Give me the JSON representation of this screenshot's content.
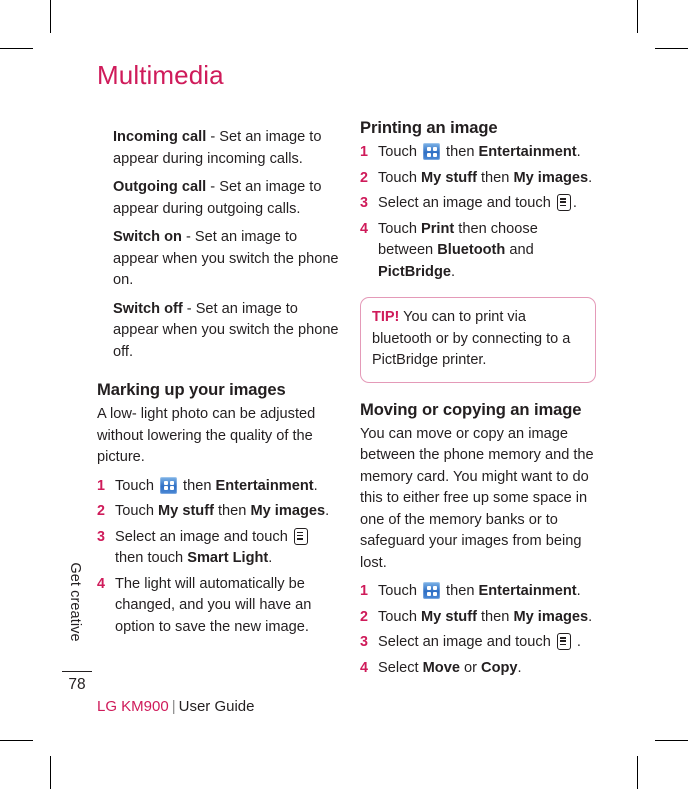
{
  "chapter": {
    "title": "Multimedia"
  },
  "side_tab": {
    "label": "Get creative",
    "page_number": "78"
  },
  "footer": {
    "brand": "LG KM900",
    "separator": "|",
    "guide": "User Guide"
  },
  "colors": {
    "accent": "#cf1b5a",
    "text": "#231f20",
    "tip_border": "#e49ab8",
    "icon_blue": "#2f6fc4"
  },
  "left_column": {
    "definitions": [
      {
        "term": "Incoming call",
        "desc": " - Set an image to appear during incoming calls."
      },
      {
        "term": "Outgoing call",
        "desc": " - Set an image to appear during outgoing calls."
      },
      {
        "term": "Switch on",
        "desc": " - Set an image to appear when you switch the phone on."
      },
      {
        "term": "Switch off",
        "desc": " - Set an image to appear when you switch the phone off."
      }
    ],
    "section": {
      "heading": "Marking up your images",
      "intro": "A low- light photo can be adjusted without lowering the quality of the picture.",
      "steps": [
        {
          "num": "1",
          "pre": "Touch ",
          "icon": "grid-apps-icon",
          "mid": " then ",
          "bold1": "Entertainment",
          "post": "."
        },
        {
          "num": "2",
          "pre": "Touch ",
          "bold1": "My stuff",
          "mid": " then ",
          "bold2": "My images",
          "post": "."
        },
        {
          "num": "3",
          "pre": "Select an image and touch ",
          "icon": "options-menu-icon",
          "mid": " then touch ",
          "bold1": "Smart Light",
          "post": "."
        },
        {
          "num": "4",
          "pre": "The light will automatically be changed, and you will have an option to save the new image."
        }
      ]
    }
  },
  "right_column": {
    "printing": {
      "heading": "Printing an image",
      "steps": [
        {
          "num": "1",
          "pre": "Touch ",
          "icon": "grid-apps-icon",
          "mid": " then ",
          "bold1": "Entertainment",
          "post": "."
        },
        {
          "num": "2",
          "pre": "Touch ",
          "bold1": "My stuff",
          "mid": " then ",
          "bold2": "My images",
          "post": "."
        },
        {
          "num": "3",
          "pre": "Select an image and touch ",
          "icon": "options-menu-icon",
          "post": "."
        },
        {
          "num": "4",
          "pre": "Touch ",
          "bold1": "Print",
          "mid": " then choose between ",
          "bold2": "Bluetooth",
          "mid2": " and ",
          "bold3": "PictBridge",
          "post": "."
        }
      ]
    },
    "tip": {
      "label": "TIP!",
      "text": " You can to print via bluetooth or by connecting to a PictBridge printer."
    },
    "moving": {
      "heading": "Moving or copying an image",
      "intro": "You can move or copy an image between the phone memory and the memory card. You might want to do this to either free up some space in one of the memory banks or to safeguard your images from being lost.",
      "steps": [
        {
          "num": "1",
          "pre": "Touch ",
          "icon": "grid-apps-icon",
          "mid": " then ",
          "bold1": "Entertainment",
          "post": "."
        },
        {
          "num": "2",
          "pre": "Touch ",
          "bold1": "My stuff",
          "mid": " then ",
          "bold2": "My images",
          "post": "."
        },
        {
          "num": "3",
          "pre": "Select an image and touch ",
          "icon": "options-menu-icon",
          "post": " ."
        },
        {
          "num": "4",
          "pre": "Select ",
          "bold1": "Move",
          "mid": " or ",
          "bold2": "Copy",
          "post": "."
        }
      ]
    }
  }
}
